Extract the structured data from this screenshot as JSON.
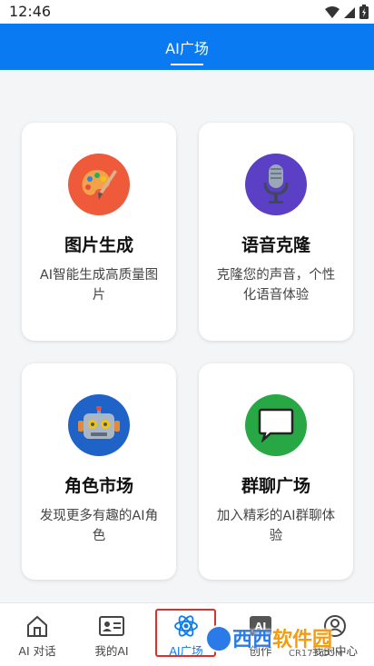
{
  "status_bar": {
    "time": "12:46"
  },
  "app_bar": {
    "title": "AI广场"
  },
  "cards": [
    {
      "title": "图片生成",
      "desc": "AI智能生成高质量图片",
      "icon": "palette-icon",
      "color": "#ef5a3a"
    },
    {
      "title": "语音克隆",
      "desc": "克隆您的声音，个性化语音体验",
      "icon": "microphone-icon",
      "color": "#5b3fc4"
    },
    {
      "title": "角色市场",
      "desc": "发现更多有趣的AI角色",
      "icon": "robot-icon",
      "color": "#1f63c9"
    },
    {
      "title": "群聊广场",
      "desc": "加入精彩的AI群聊体验",
      "icon": "chat-bubble-icon",
      "color": "#27a845"
    }
  ],
  "bottom_nav": [
    {
      "label": "AI 对话",
      "icon": "home-icon",
      "active": false
    },
    {
      "label": "我的AI",
      "icon": "id-card-icon",
      "active": false
    },
    {
      "label": "AI广场",
      "icon": "atom-icon",
      "active": true
    },
    {
      "label": "创作",
      "icon": "ai-icon",
      "active": false
    },
    {
      "label": "我的中心",
      "icon": "profile-icon",
      "active": false
    }
  ],
  "watermark": {
    "brand_a": "西西",
    "brand_b": "软件园",
    "url": "CR173.COM"
  },
  "colors": {
    "accent": "#0a7af3",
    "highlight": "#d6322e"
  }
}
